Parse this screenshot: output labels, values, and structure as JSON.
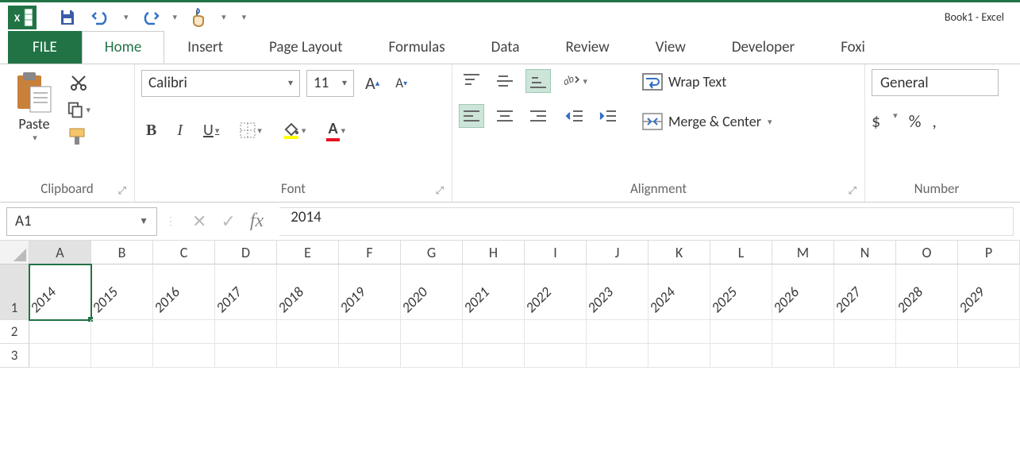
{
  "app_title": "Book1 - Excel",
  "tabs": {
    "file": "FILE",
    "list": [
      "Home",
      "Insert",
      "Page Layout",
      "Formulas",
      "Data",
      "Review",
      "View",
      "Developer",
      "Foxi"
    ],
    "active": "Home"
  },
  "ribbon": {
    "clipboard": {
      "paste": "Paste",
      "label": "Clipboard"
    },
    "font": {
      "name": "Calibri",
      "size": "11",
      "bold": "B",
      "italic": "I",
      "under": "U",
      "label": "Font"
    },
    "alignment": {
      "wrap": "Wrap Text",
      "merge": "Merge & Center",
      "label": "Alignment"
    },
    "number": {
      "format": "General",
      "currency": "$",
      "percent": "%",
      "comma": ",",
      "label": "Number"
    }
  },
  "formula_bar": {
    "name_box": "A1",
    "fx": "fx",
    "value": "2014"
  },
  "grid": {
    "columns": [
      "A",
      "B",
      "C",
      "D",
      "E",
      "F",
      "G",
      "H",
      "I",
      "J",
      "K",
      "L",
      "M",
      "N",
      "O",
      "P"
    ],
    "active_col": "A",
    "rows": [
      {
        "num": "1",
        "height": "tall",
        "cells": [
          "2014",
          "2015",
          "2016",
          "2017",
          "2018",
          "2019",
          "2020",
          "2021",
          "2022",
          "2023",
          "2024",
          "2025",
          "2026",
          "2027",
          "2028",
          "2029"
        ]
      },
      {
        "num": "2",
        "height": "",
        "cells": [
          "",
          "",
          "",
          "",
          "",
          "",
          "",
          "",
          "",
          "",
          "",
          "",
          "",
          "",
          "",
          ""
        ]
      },
      {
        "num": "3",
        "height": "",
        "cells": [
          "",
          "",
          "",
          "",
          "",
          "",
          "",
          "",
          "",
          "",
          "",
          "",
          "",
          "",
          "",
          ""
        ]
      }
    ],
    "selected": {
      "row": 0,
      "col": 0
    }
  }
}
